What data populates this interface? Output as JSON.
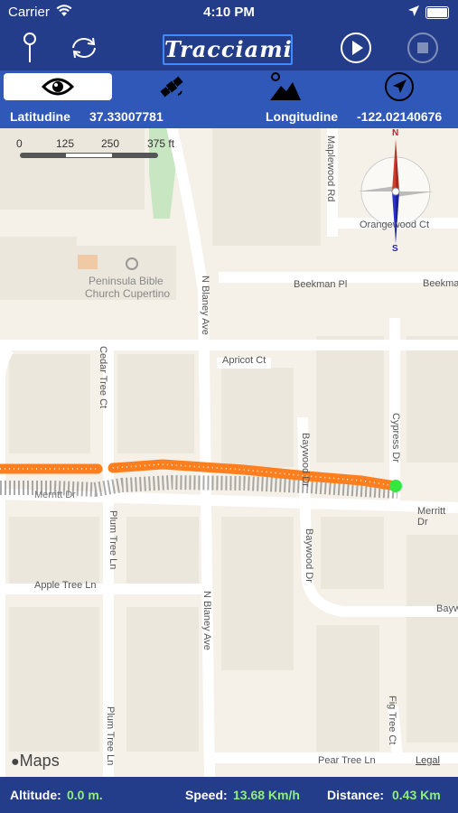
{
  "status": {
    "carrier": "Carrier",
    "time": "4:10 PM"
  },
  "toolbar": {
    "logo_text": "Tracciami"
  },
  "tabs": [
    "view",
    "satellite",
    "terrain",
    "navigate"
  ],
  "coords": {
    "lat_label": "Latitudine",
    "lat_value": "37.33007781",
    "lon_label": "Longitudine",
    "lon_value": "-122.02140676"
  },
  "map": {
    "scale": {
      "t0": "0",
      "t1": "125",
      "t2": "250",
      "t3": "375 ft"
    },
    "labels": {
      "maplewood": "Maplewood Rd",
      "orangewood": "Orangewood Ct",
      "church1": "Peninsula Bible",
      "church2": "Church Cupertino",
      "beekman": "Beekman Pl",
      "beekman2": "Beekma",
      "blaney1": "N Blaney Ave",
      "blaney2": "N Blaney Ave",
      "cedar": "Cedar Tree Ct",
      "apricot": "Apricot Ct",
      "baywood": "Baywood Dr",
      "baywood2": "Baywood Dr",
      "cypress": "Cypress Dr",
      "merritt": "Merritt Dr",
      "merritt2": "Merritt Dr",
      "plum": "Plum Tree Ln",
      "plum2": "Plum Tree Ln",
      "apple": "Apple Tree Ln",
      "bayw": "Bayw",
      "pear": "Pear Tree Ln",
      "fig": "Fig Tree Ct",
      "legal": "Legal",
      "maps": "Maps",
      "compass_n": "N",
      "compass_s": "S"
    }
  },
  "bottom": {
    "altitude_label": "Altitude:",
    "altitude_value": "0.0 m.",
    "speed_label": "Speed:",
    "speed_value": "13.68 Km/h",
    "distance_label": "Distance:",
    "distance_value": "0.43 Km"
  },
  "colors": {
    "bar": "#243d8a",
    "tab": "#2f58b8",
    "track": "#ff7f1f",
    "end": "#35e640"
  }
}
